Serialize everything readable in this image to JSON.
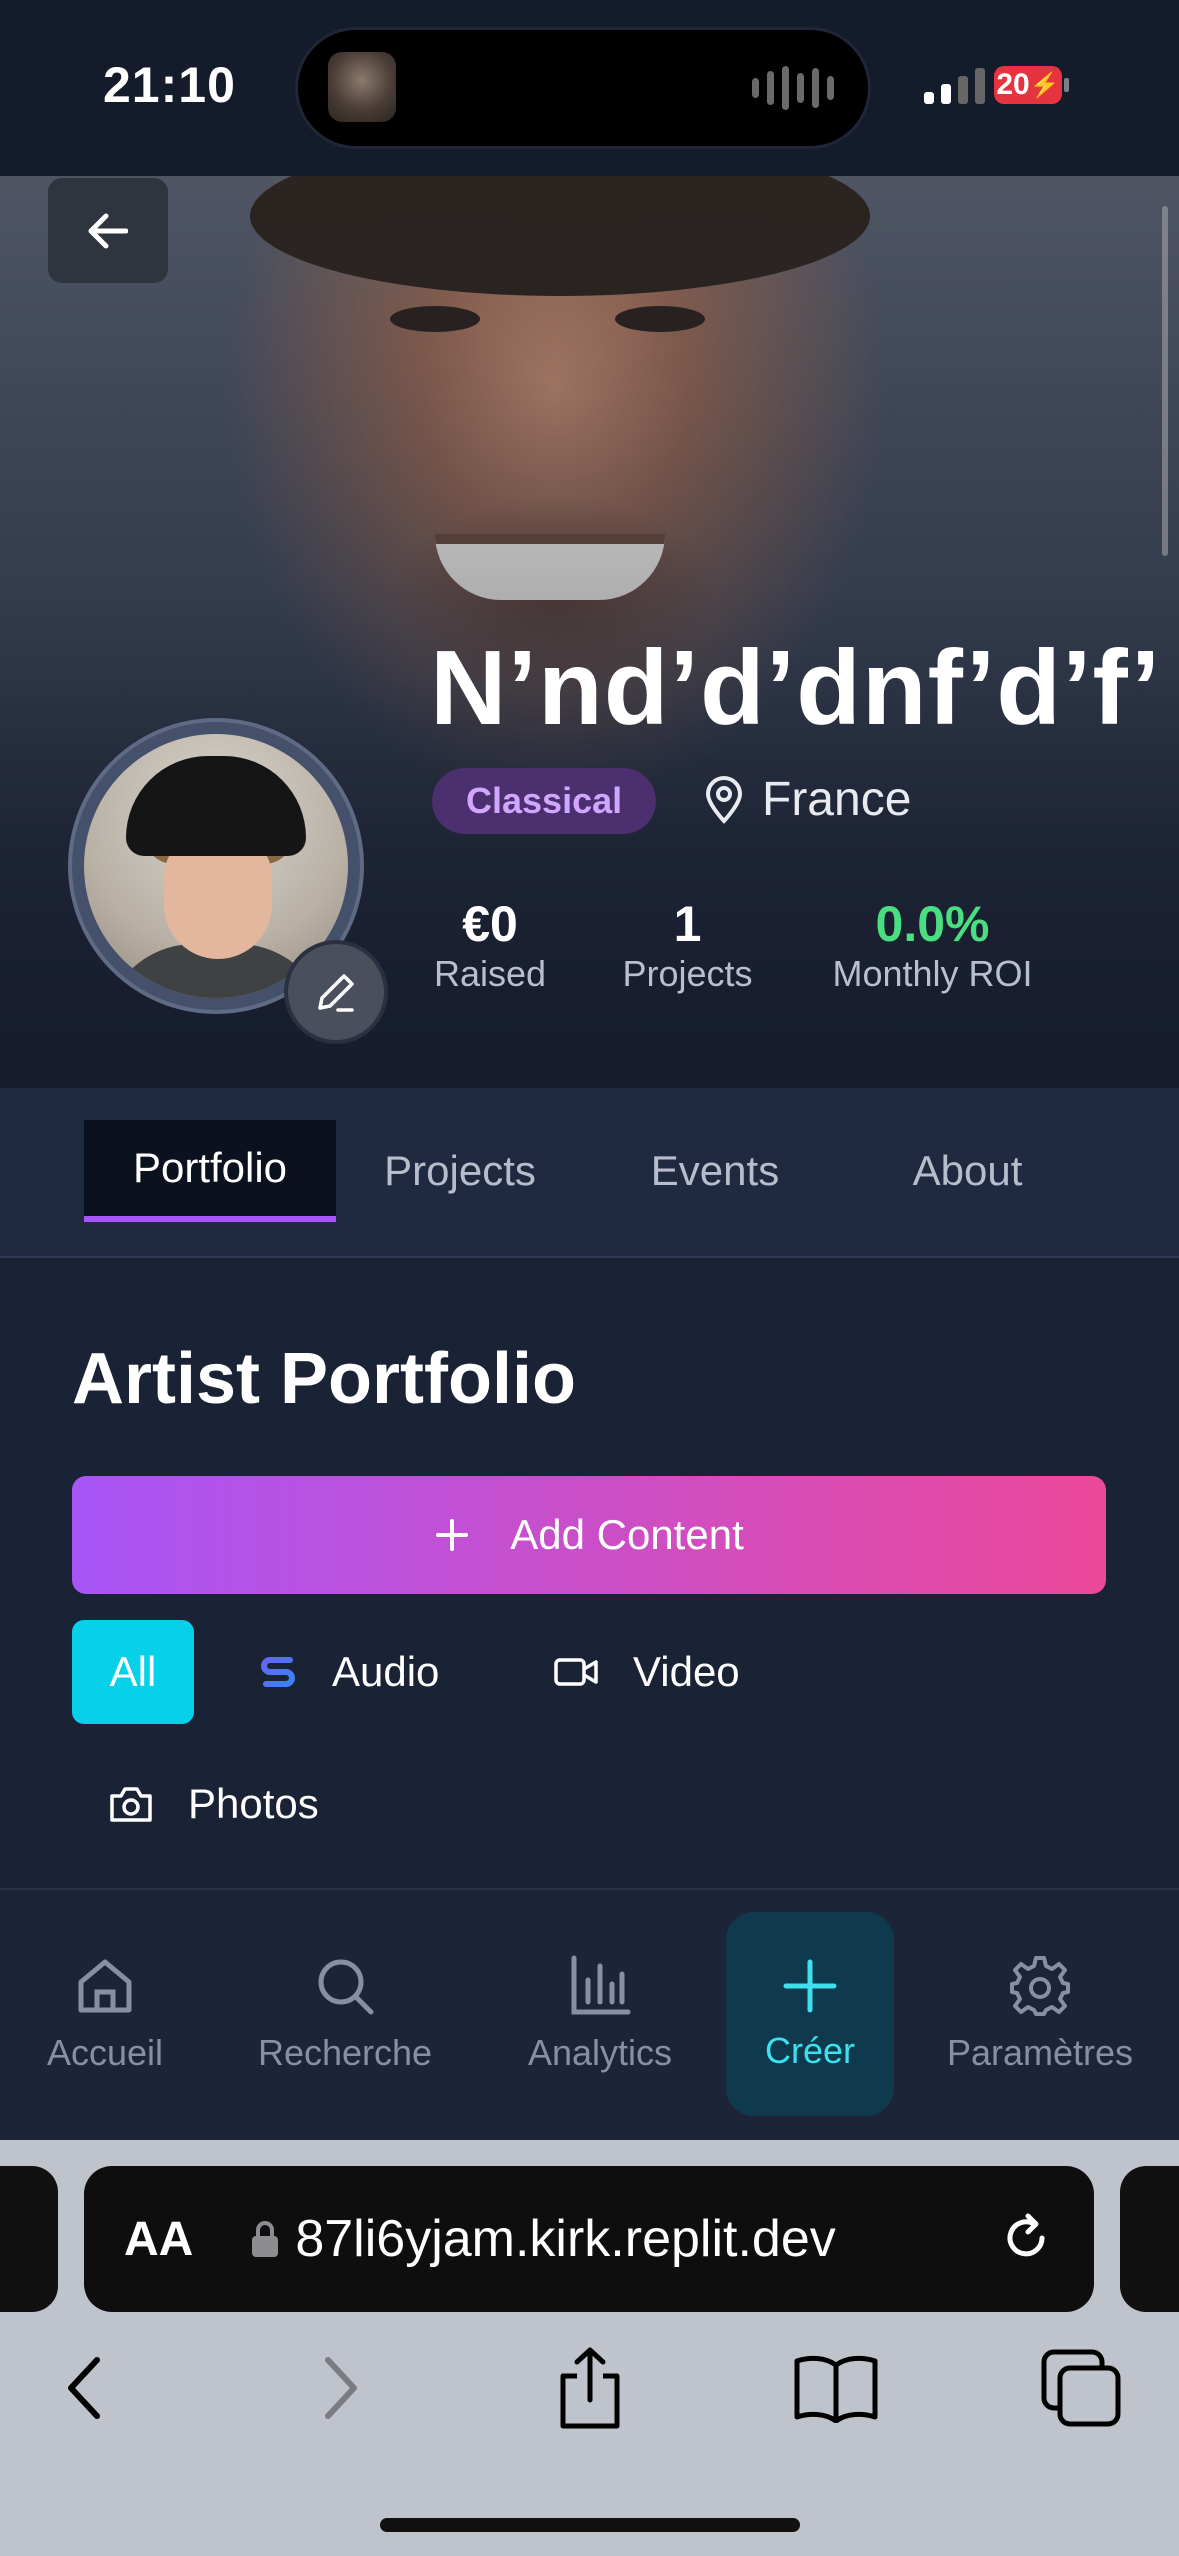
{
  "status_bar": {
    "time": "21:10",
    "battery": "20"
  },
  "profile": {
    "name": "N’nd’d’dnf’d’f’",
    "genre": "Classical",
    "location": "France",
    "stats": [
      {
        "value": "€0",
        "label": "Raised"
      },
      {
        "value": "1",
        "label": "Projects"
      },
      {
        "value": "0.0%",
        "label": "Monthly ROI"
      }
    ]
  },
  "tabs": [
    {
      "label": "Portfolio",
      "active": true
    },
    {
      "label": "Projects"
    },
    {
      "label": "Events"
    },
    {
      "label": "About"
    }
  ],
  "portfolio": {
    "title": "Artist Portfolio",
    "add_button": "Add Content",
    "filters": [
      {
        "label": "All",
        "active": true
      },
      {
        "label": "Audio",
        "icon": "audio-icon"
      },
      {
        "label": "Video",
        "icon": "video-icon"
      },
      {
        "label": "Photos",
        "icon": "camera-icon"
      }
    ]
  },
  "bottom_nav": [
    {
      "label": "Accueil",
      "icon": "home-icon"
    },
    {
      "label": "Recherche",
      "icon": "search-icon"
    },
    {
      "label": "Analytics",
      "icon": "bar-chart-icon"
    },
    {
      "label": "Créer",
      "icon": "plus-icon",
      "active": true
    },
    {
      "label": "Paramètres",
      "icon": "gear-icon"
    }
  ],
  "browser": {
    "text_size_label": "AA",
    "url": "87li6yjam.kirk.replit.dev"
  },
  "colors": {
    "accent_purple": "#a855f7",
    "accent_pink": "#ec4899",
    "accent_cyan": "#06d1e8",
    "roi_green": "#4ade80"
  }
}
